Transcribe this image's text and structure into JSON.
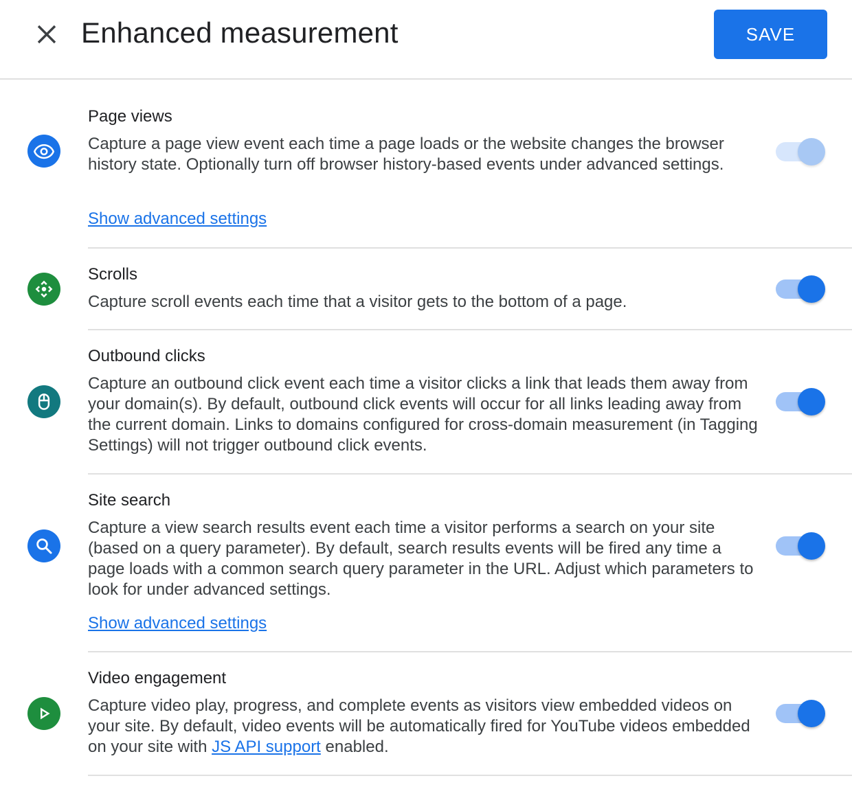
{
  "header": {
    "title": "Enhanced measurement",
    "save_label": "SAVE",
    "close_icon": "close-icon"
  },
  "colors": {
    "primary": "#1a73e8",
    "green": "#1e8e3e",
    "teal": "#12797f",
    "toggle_track_on": "#a0c3f7",
    "toggle_disabled_track": "#d7e6fc",
    "toggle_disabled_thumb": "#a8c8f4",
    "divider": "#e0e0e0"
  },
  "sections": [
    {
      "title": "Page views",
      "icon": "eye-icon",
      "description": "Capture a page view event each time a page loads or the website changes the browser history state. Optionally turn off browser history-based events under advanced settings.",
      "link": "Show advanced settings",
      "enabled": true,
      "toggle_disabled": true
    },
    {
      "title": "Scrolls",
      "icon": "scroll-icon",
      "description": "Capture scroll events each time that a visitor gets to the bottom of a page.",
      "enabled": true,
      "toggle_disabled": false
    },
    {
      "title": "Outbound clicks",
      "icon": "mouse-icon",
      "description": "Capture an outbound click event each time a visitor clicks a link that leads them away from your domain(s). By default, outbound click events will occur for all links leading away from the current domain. Links to domains configured for cross-domain measurement (in Tagging Settings) will not trigger outbound click events.",
      "enabled": true,
      "toggle_disabled": false
    },
    {
      "title": "Site search",
      "icon": "search-icon",
      "description": "Capture a view search results event each time a visitor performs a search on your site (based on a query parameter). By default, search results events will be fired any time a page loads with a common search query parameter in the URL. Adjust which parameters to look for under advanced settings.",
      "link": "Show advanced settings",
      "enabled": true,
      "toggle_disabled": false
    },
    {
      "title": "Video engagement",
      "icon": "play-icon",
      "description_before": "Capture video play, progress, and complete events as visitors view embedded videos on your site. By default, video events will be automatically fired for YouTube videos embedded on your site with ",
      "description_link": "JS API support",
      "description_after": " enabled.",
      "enabled": true,
      "toggle_disabled": false
    }
  ]
}
